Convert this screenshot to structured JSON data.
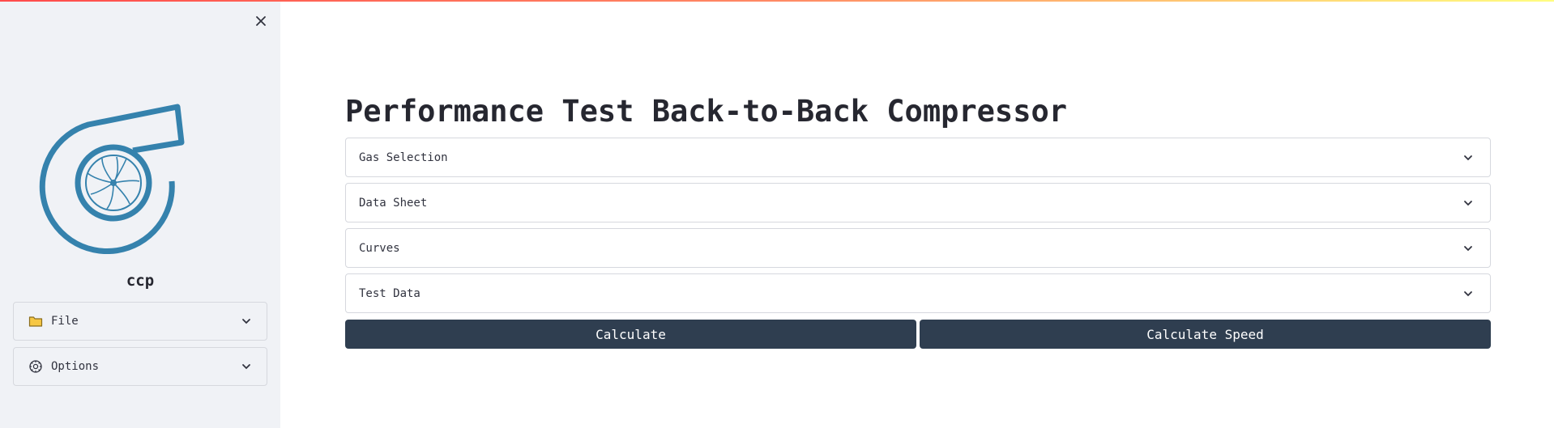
{
  "app": {
    "name": "ccp",
    "title": "Performance Test Back-to-Back Compressor"
  },
  "sidebar": {
    "items": [
      {
        "label": "File",
        "icon": "folder-icon"
      },
      {
        "label": "Options",
        "icon": "settings-gear-icon"
      }
    ]
  },
  "main": {
    "expanders": [
      {
        "label": "Gas Selection"
      },
      {
        "label": "Data Sheet"
      },
      {
        "label": "Curves"
      },
      {
        "label": "Test Data"
      }
    ],
    "buttons": {
      "calculate": "Calculate",
      "calculate_speed": "Calculate Speed"
    }
  },
  "colors": {
    "sidebar_bg": "#f0f2f6",
    "logo": "#3582ad",
    "button_bg": "#2f3e50",
    "text": "#262730"
  }
}
